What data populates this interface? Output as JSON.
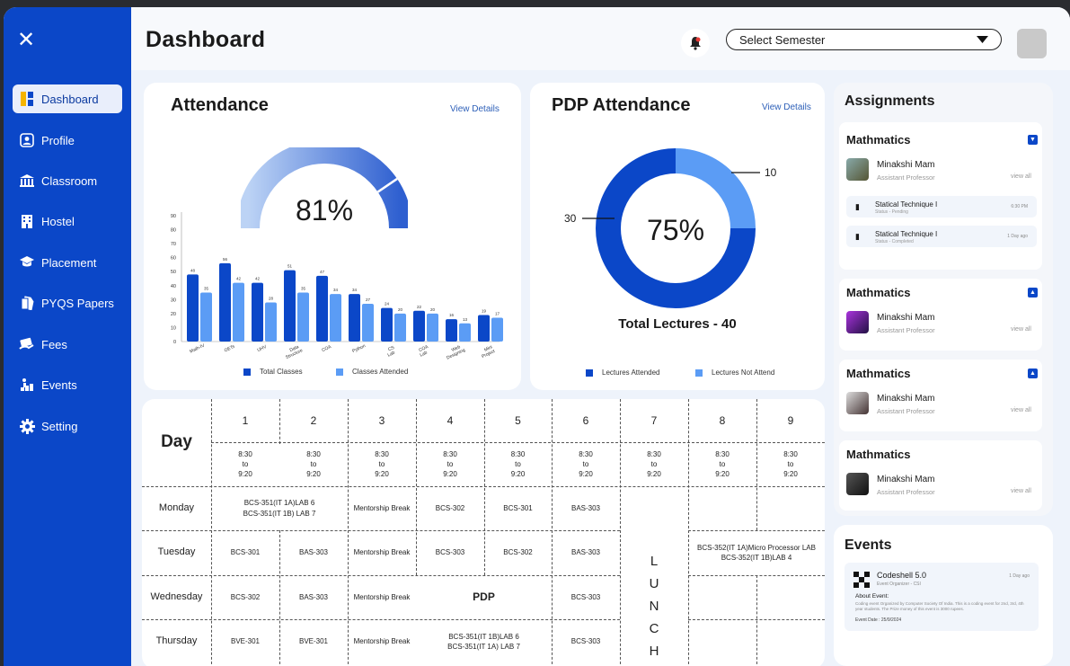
{
  "sidebar": {
    "items": [
      {
        "label": "Dashboard",
        "icon": "dashboard-icon"
      },
      {
        "label": "Profile",
        "icon": "profile-icon"
      },
      {
        "label": "Classroom",
        "icon": "classroom-icon"
      },
      {
        "label": "Hostel",
        "icon": "hostel-icon"
      },
      {
        "label": "Placement",
        "icon": "placement-icon"
      },
      {
        "label": "PYQS Papers",
        "icon": "papers-icon"
      },
      {
        "label": "Fees",
        "icon": "fees-icon"
      },
      {
        "label": "Events",
        "icon": "events-icon"
      },
      {
        "label": "Setting",
        "icon": "setting-icon"
      }
    ]
  },
  "header": {
    "title": "Dashboard",
    "semester_placeholder": "Select Semester"
  },
  "colors": {
    "primary": "#0b47c8",
    "light": "#5b9cf5"
  },
  "attendance": {
    "title": "Attendance",
    "view_details": "View Details",
    "percent_label": "81%",
    "gauge_value": 0.81,
    "chart_data": {
      "type": "bar",
      "categories": [
        "Math-IV",
        "OETs",
        "UHV",
        "Data Structure",
        "COA",
        "Python",
        "CS Lab",
        "COA Lab",
        "Web Designing",
        "Mini Project"
      ],
      "series": [
        {
          "name": "Total Classes",
          "values": [
            48,
            56,
            42,
            51,
            47,
            34,
            24,
            22,
            16,
            19
          ]
        },
        {
          "name": "Classes Attended",
          "values": [
            35,
            42,
            28,
            35,
            34,
            27,
            20,
            20,
            13,
            17
          ]
        }
      ],
      "yticks": [
        0,
        10,
        20,
        30,
        40,
        50,
        60,
        70,
        80,
        90
      ],
      "ylim": [
        0,
        90
      ]
    }
  },
  "pdp": {
    "title": "PDP Attendance",
    "view_details": "View Details",
    "percent_label": "75%",
    "total": "Total Lectures - 40",
    "chart_data": {
      "type": "pie",
      "labels": [
        "Lectures Attended",
        "Lectures Not Attend"
      ],
      "values": [
        30,
        10
      ]
    },
    "callouts": [
      "30",
      "10"
    ]
  },
  "timetable": {
    "day_label": "Day",
    "periods": [
      "1",
      "2",
      "3",
      "4",
      "5",
      "6",
      "7",
      "8",
      "9"
    ],
    "time": [
      "8:30",
      "to",
      "9:20"
    ],
    "days": [
      "Monday",
      "Tuesday",
      "Wednesday",
      "Thursday"
    ],
    "lunch": [
      "L",
      "U",
      "N",
      "C",
      "H"
    ],
    "monday": {
      "p12": [
        "BCS-351(IT 1A)LAB 6",
        "BCS-351(IT 1B) LAB 7"
      ],
      "p3": "Mentorship Break",
      "p4": "BCS-302",
      "p5": "BCS-301",
      "p6": "BAS-303"
    },
    "tuesday": {
      "p1": "BCS-301",
      "p2": "BAS-303",
      "p3": "Mentorship Break",
      "p4": "BCS-303",
      "p5": "BCS-302",
      "p6": "BAS-303",
      "p89": [
        "BCS-352(IT 1A)Micro Processor LAB",
        "BCS-352(IT 1B)LAB 4"
      ]
    },
    "wednesday": {
      "p1": "BCS-302",
      "p2": "BAS-303",
      "p3": "Mentorship Break",
      "p45": "PDP",
      "p6": "BCS-303"
    },
    "thursday": {
      "p1": "BVE-301",
      "p2": "BVE-301",
      "p3": "Mentorship Break",
      "p45": [
        "BCS-351(IT 1B)LAB 6",
        "BCS-351(IT 1A) LAB 7"
      ],
      "p6": "BCS-303"
    }
  },
  "assignments": {
    "title": "Assignments",
    "cards": [
      {
        "subject": "Mathmatics",
        "name": "Minakshi Mam",
        "role": "Assistant Professor",
        "view": "view all",
        "tasks": [
          {
            "name": "Statical Technique I",
            "status": "Status - Pending",
            "time": "6:30 PM"
          },
          {
            "name": "Statical Technique I",
            "status": "Status - Completed",
            "time": "1 Day ago"
          }
        ]
      },
      {
        "subject": "Mathmatics",
        "name": "Minakshi Mam",
        "role": "Assistant Professor",
        "view": "view all"
      },
      {
        "subject": "Mathmatics",
        "name": "Minakshi Mam",
        "role": "Assistant Professor",
        "view": "view all"
      },
      {
        "subject": "Mathmatics",
        "name": "Minakshi Mam",
        "role": "Assistant Professor",
        "view": "view all"
      }
    ]
  },
  "events": {
    "title": "Events",
    "item": {
      "name": "Codeshell 5.0",
      "org": "Event Organizer - CSI",
      "time": "1 Day ago",
      "about_label": "About Event:",
      "about_text": "Coding event Organized by Computer Society Of India. This is a coding event for 2nd, 3rd, 4th year students. The Prize money of this event is 3000 rupees.",
      "date": "Event Date : 25/9/2024"
    }
  }
}
